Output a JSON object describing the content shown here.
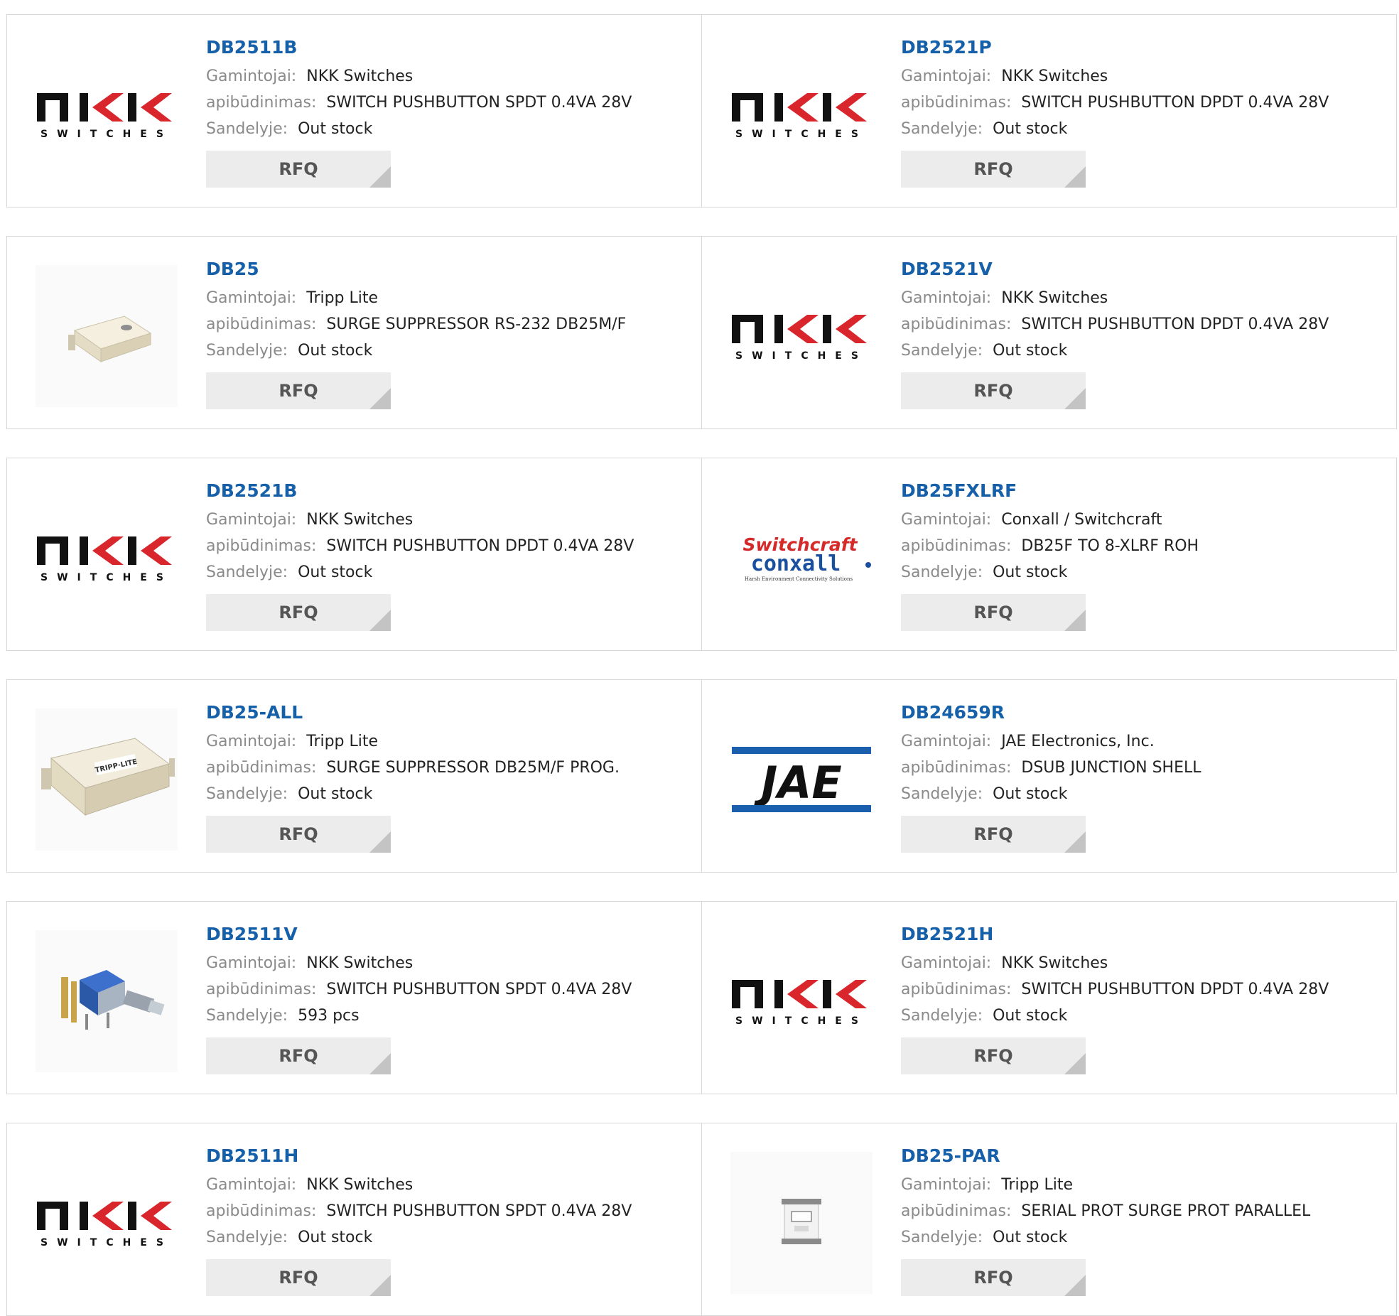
{
  "labels": {
    "manufacturer": "Gamintojai:",
    "description": "apibūdinimas:",
    "stock": "Sandelyje:",
    "rfq": "RFQ"
  },
  "rows": [
    [
      {
        "part": "DB2511B",
        "manufacturer": "NKK Switches",
        "description": "SWITCH PUSHBUTTON SPDT 0.4VA 28V",
        "stock": "Out stock",
        "image": "nkk-logo"
      },
      {
        "part": "DB2521P",
        "manufacturer": "NKK Switches",
        "description": "SWITCH PUSHBUTTON DPDT 0.4VA 28V",
        "stock": "Out stock",
        "image": "nkk-logo"
      }
    ],
    [
      {
        "part": "DB25",
        "manufacturer": "Tripp Lite",
        "description": "SURGE SUPPRESSOR RS-232 DB25M/F",
        "stock": "Out stock",
        "image": "surge-suppressor-photo"
      },
      {
        "part": "DB2521V",
        "manufacturer": "NKK Switches",
        "description": "SWITCH PUSHBUTTON DPDT 0.4VA 28V",
        "stock": "Out stock",
        "image": "nkk-logo"
      }
    ],
    [
      {
        "part": "DB2521B",
        "manufacturer": "NKK Switches",
        "description": "SWITCH PUSHBUTTON DPDT 0.4VA 28V",
        "stock": "Out stock",
        "image": "nkk-logo"
      },
      {
        "part": "DB25FXLRF",
        "manufacturer": "Conxall / Switchcraft",
        "description": "DB25F TO 8-XLRF ROH",
        "stock": "Out stock",
        "image": "switchcraft-conxall-logo"
      }
    ],
    [
      {
        "part": "DB25-ALL",
        "manufacturer": "Tripp Lite",
        "description": "SURGE SUPPRESSOR DB25M/F PROG.",
        "stock": "Out stock",
        "image": "surge-suppressor-large-photo"
      },
      {
        "part": "DB24659R",
        "manufacturer": "JAE Electronics, Inc.",
        "description": "DSUB JUNCTION SHELL",
        "stock": "Out stock",
        "image": "jae-logo"
      }
    ],
    [
      {
        "part": "DB2511V",
        "manufacturer": "NKK Switches",
        "description": "SWITCH PUSHBUTTON SPDT 0.4VA 28V",
        "stock": "593 pcs",
        "image": "pushbutton-switch-photo"
      },
      {
        "part": "DB2521H",
        "manufacturer": "NKK Switches",
        "description": "SWITCH PUSHBUTTON DPDT 0.4VA 28V",
        "stock": "Out stock",
        "image": "nkk-logo"
      }
    ],
    [
      {
        "part": "DB2511H",
        "manufacturer": "NKK Switches",
        "description": "SWITCH PUSHBUTTON SPDT 0.4VA 28V",
        "stock": "Out stock",
        "image": "nkk-logo"
      },
      {
        "part": "DB25-PAR",
        "manufacturer": "Tripp Lite",
        "description": "SERIAL PROT SURGE PROT PARALLEL",
        "stock": "Out stock",
        "image": "parallel-protector-photo"
      }
    ]
  ],
  "logo_text": {
    "nkk_sub": "SWITCHES",
    "switchcraft": "Switchcraft",
    "conxall": "conxall",
    "conxall_tag": "Harsh Environment Connectivity Solutions",
    "jae": "JAE",
    "tripp": "TRIPP·LITE"
  },
  "colors": {
    "link": "#1560a8",
    "label": "#8a8a8a",
    "border": "#d6d6d6",
    "rfq_bg": "#ececec",
    "jae_blue": "#1a5fad",
    "switchcraft_red": "#d42a2a",
    "conxall_blue": "#1a4fa0"
  }
}
